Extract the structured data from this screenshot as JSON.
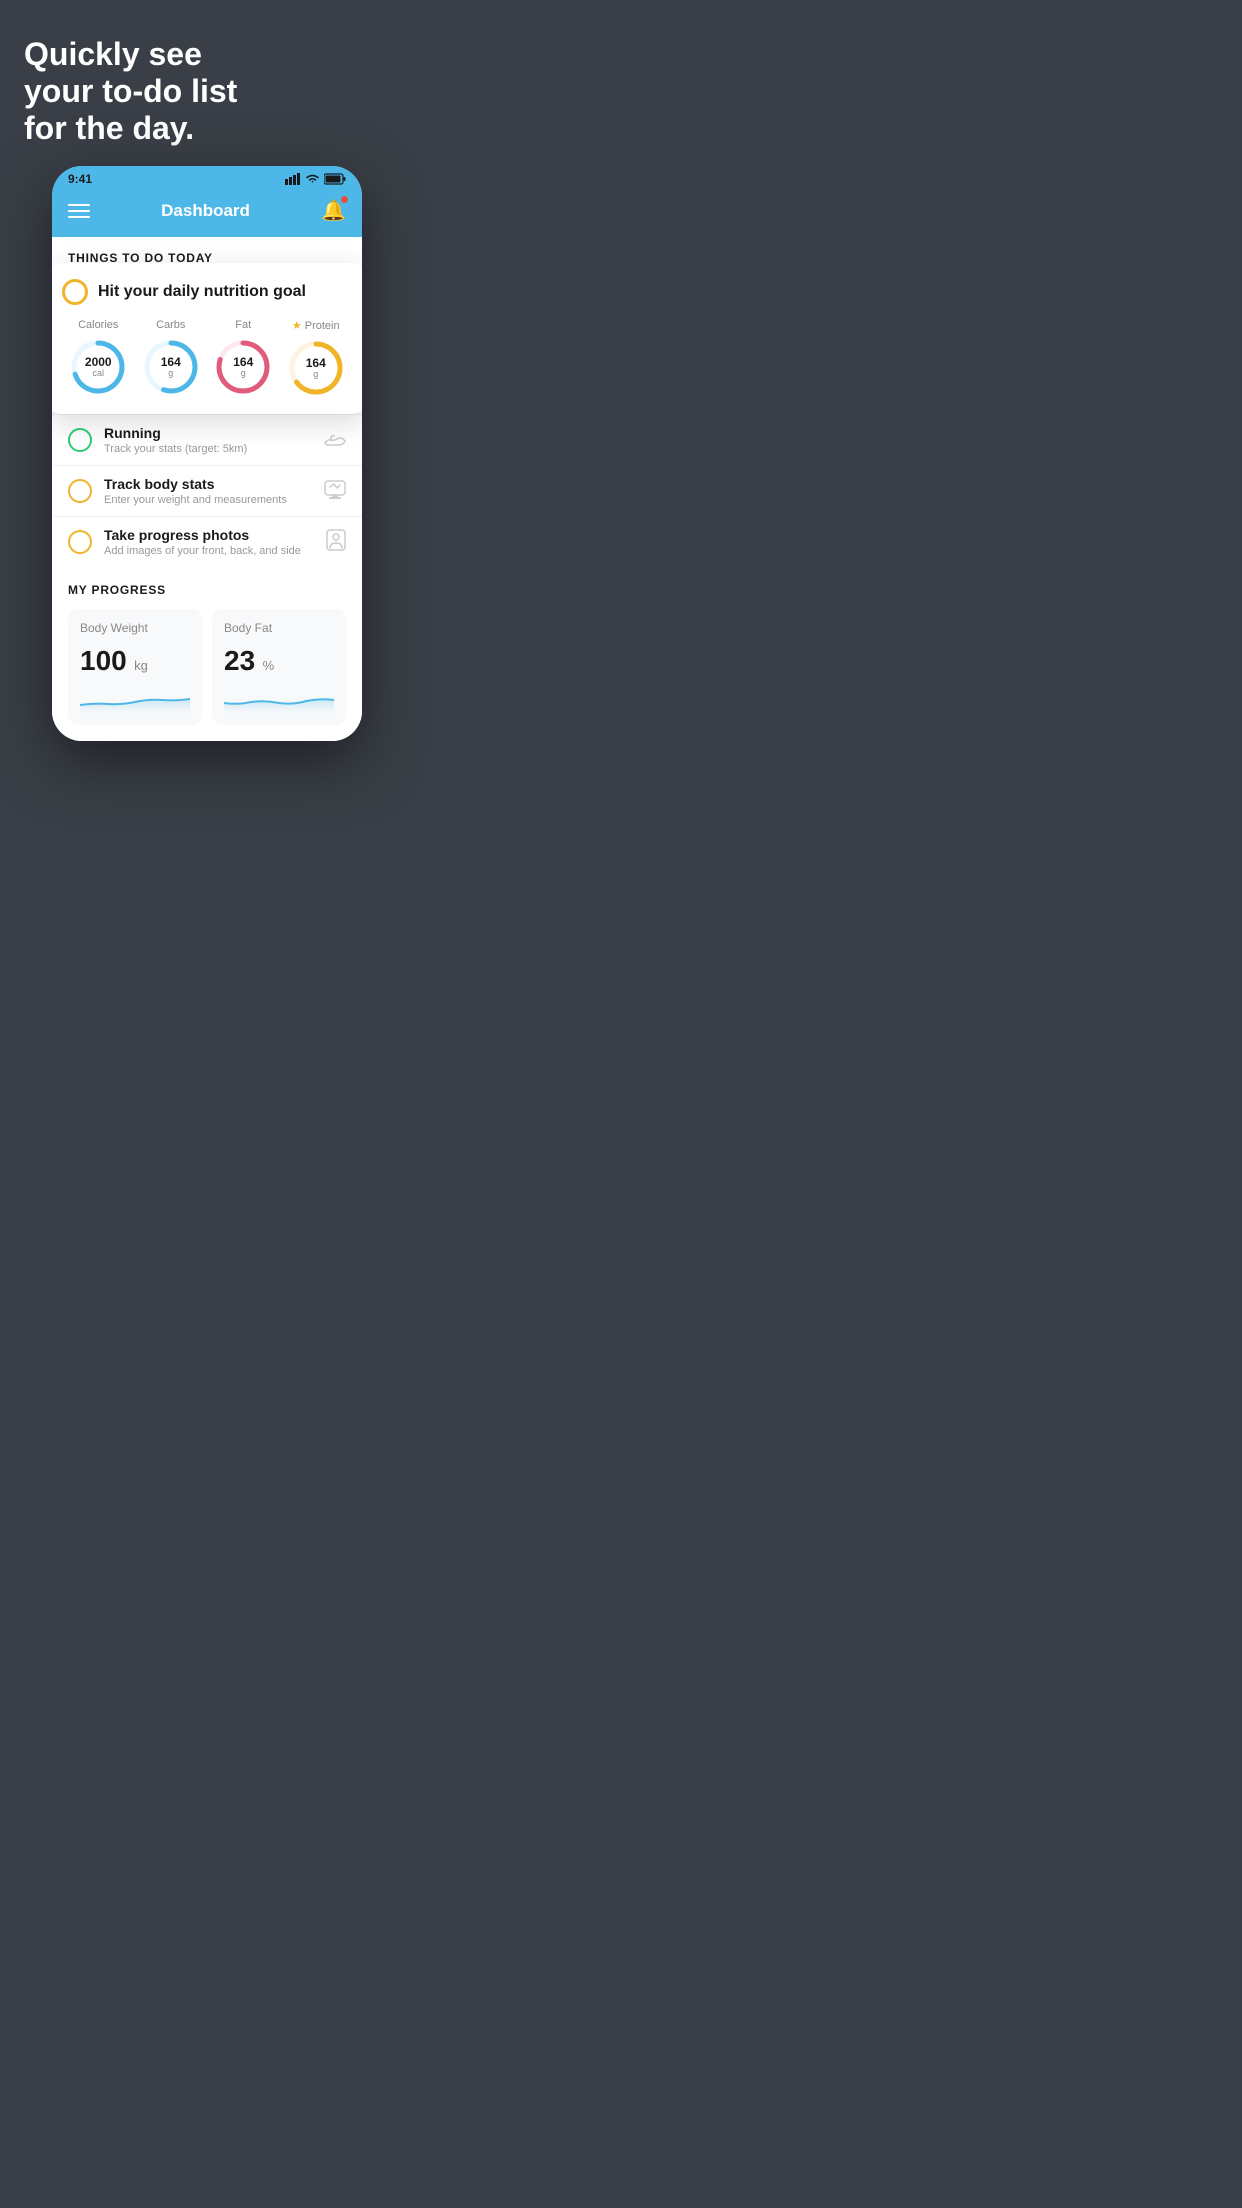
{
  "hero": {
    "line1": "Quickly see",
    "line2": "your to-do list",
    "line3": "for the day."
  },
  "statusBar": {
    "time": "9:41",
    "signal": "▌▌▌",
    "wifi": "wifi",
    "battery": "battery"
  },
  "header": {
    "title": "Dashboard"
  },
  "sectionTodo": {
    "label": "THINGS TO DO TODAY"
  },
  "nutritionCard": {
    "checkLabel": "Hit your daily nutrition goal",
    "cols": [
      {
        "label": "Calories",
        "value": "2000",
        "unit": "cal",
        "color": "#4db8e8",
        "pct": 70,
        "starred": false
      },
      {
        "label": "Carbs",
        "value": "164",
        "unit": "g",
        "color": "#4db8e8",
        "pct": 55,
        "starred": false
      },
      {
        "label": "Fat",
        "value": "164",
        "unit": "g",
        "color": "#e05c7a",
        "pct": 80,
        "starred": false
      },
      {
        "label": "Protein",
        "value": "164",
        "unit": "g",
        "color": "#f0b429",
        "pct": 65,
        "starred": true
      }
    ]
  },
  "todoItems": [
    {
      "type": "green",
      "title": "Running",
      "subtitle": "Track your stats (target: 5km)",
      "icon": "shoe"
    },
    {
      "type": "yellow",
      "title": "Track body stats",
      "subtitle": "Enter your weight and measurements",
      "icon": "scale"
    },
    {
      "type": "yellow",
      "title": "Take progress photos",
      "subtitle": "Add images of your front, back, and side",
      "icon": "person"
    }
  ],
  "progress": {
    "label": "MY PROGRESS",
    "cards": [
      {
        "title": "Body Weight",
        "value": "100",
        "unit": "kg"
      },
      {
        "title": "Body Fat",
        "value": "23",
        "unit": "%"
      }
    ]
  }
}
